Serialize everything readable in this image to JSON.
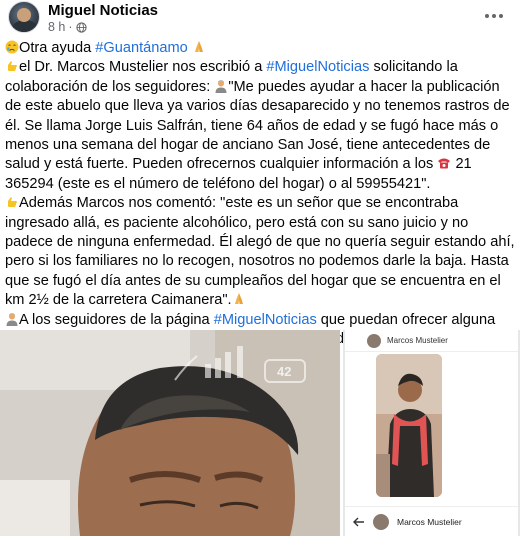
{
  "post": {
    "page_name": "Miguel Noticias",
    "time": "8 h",
    "separator": "·"
  },
  "content": {
    "l1_a": "Otra ayuda ",
    "l1_tag": "#Guantánamo",
    "l2_a": "el Dr. Marcos Mustelier nos escribió a ",
    "l2_tag": "#MiguelNoticias",
    "l2_b": " solicitando la colaboración de los seguidores: ",
    "l2_quote": "\"Me puedes ayudar a hacer la publicación de este abuelo que lleva ya varios días desaparecido y no tenemos rastros de él. Se llama Jorge Luis Salfrán, tiene 64 años de edad y se fugó hace más o menos una semana del hogar de anciano San José, tiene antecedentes de salud y está fuerte. Pueden ofrecernos cualquier información a los ",
    "l2_phone": " 21 365294 (este es el número de teléfono del hogar) o al 59955421\".",
    "l3": "Además Marcos nos comentó: \"este es un señor que se encontraba ingresado allá, es paciente alcohólico, pero está con su sano juicio y no padece de ninguna enfermedad. Él alegó de que no quería seguir estando ahí, pero si los familiares no lo recogen, nosotros no podemos darle la baja. Hasta que se fugó el día antes de su cumpleaños del hogar que se encuentra en el km 2½ de la carretera Caimanera\".",
    "l4_a": "A los seguidores de la página ",
    "l4_tag": "#MiguelNoticias",
    "l4_b": " que puedan ofrecer alguna información, por favor llamar a los números publicados."
  },
  "photo_left": {
    "battery": "42"
  },
  "photo_right": {
    "contact_top": "Marcos Mustelier",
    "contact_bottom": "Marcos Mustelier"
  },
  "colors": {
    "link": "#216fdb",
    "secondary_text": "#65676b"
  },
  "icons": [
    "globe-icon",
    "more-icon",
    "crying-face-icon",
    "pray-icon",
    "pointing-hand-icon",
    "person-icon",
    "phone-icon",
    "back-arrow-icon"
  ]
}
